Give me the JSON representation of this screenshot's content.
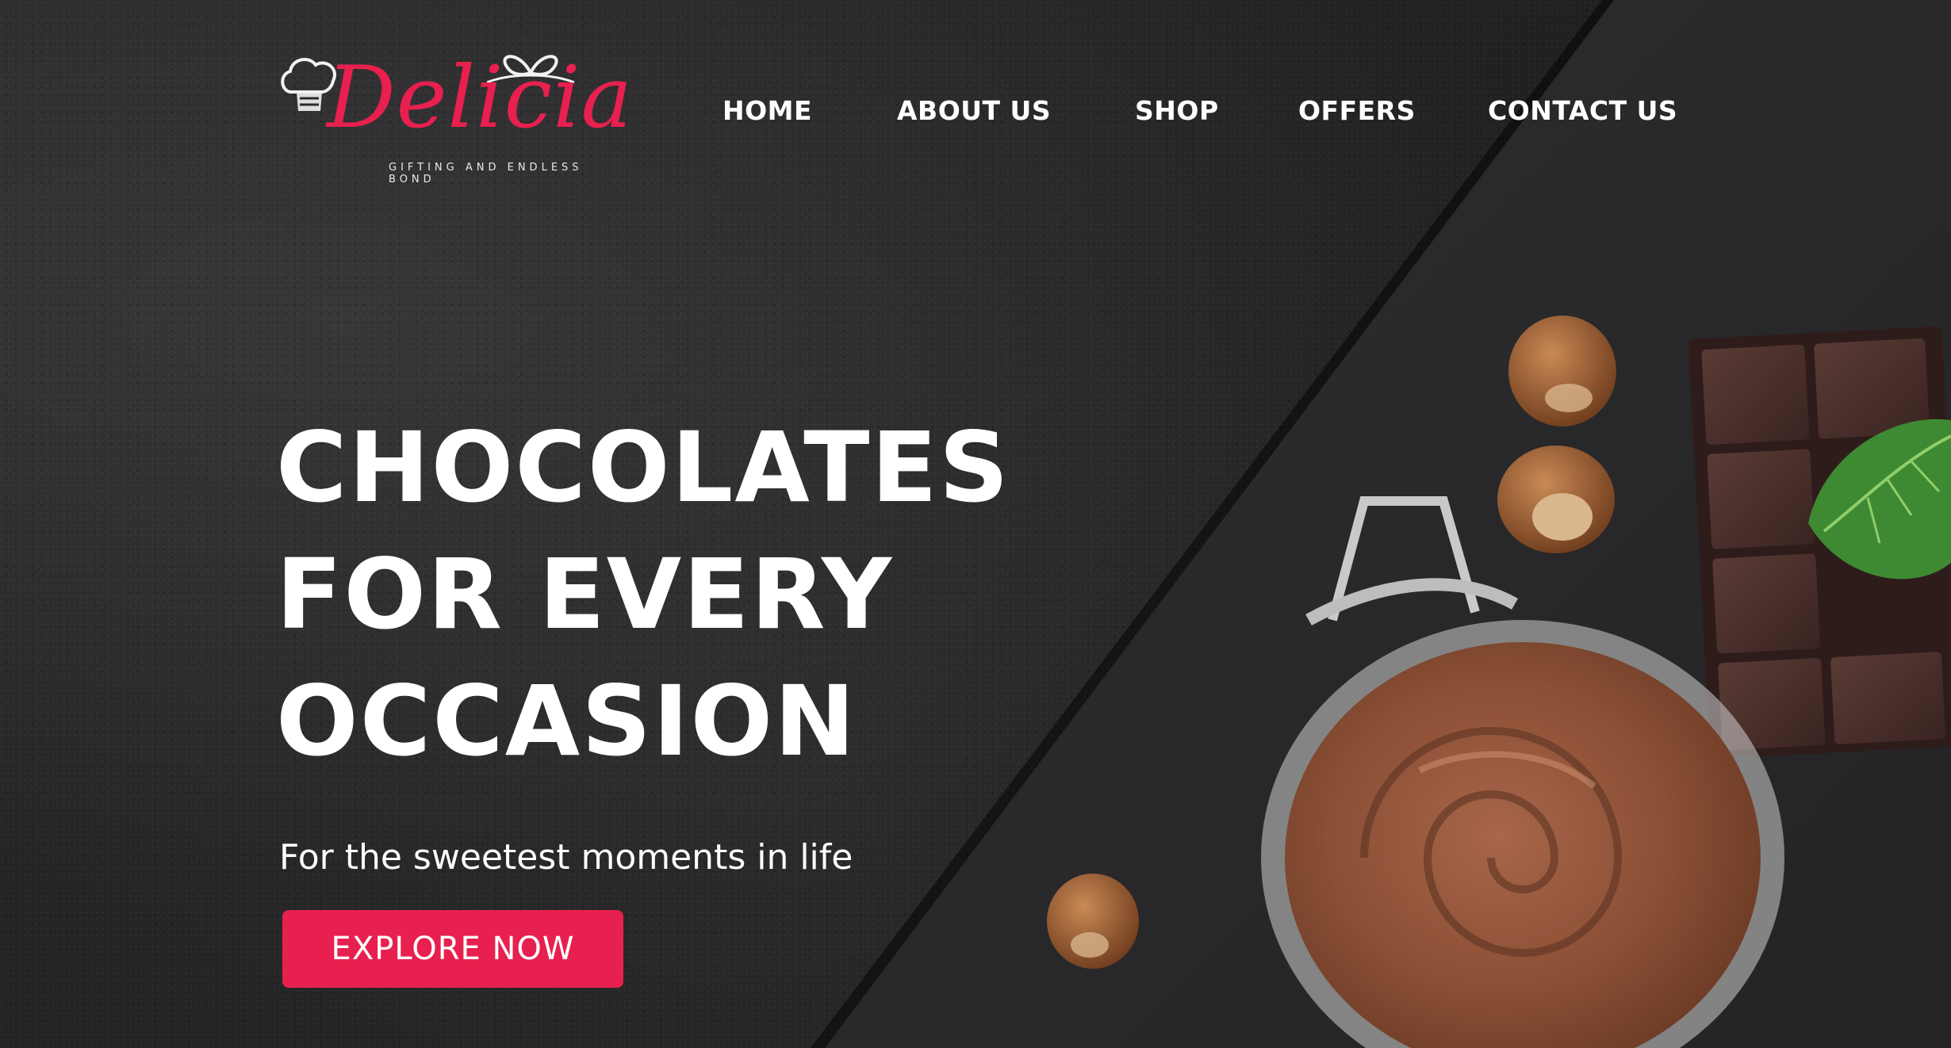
{
  "brand": {
    "name": "Delicia",
    "tagline": "GIFTING AND ENDLESS BOND",
    "primary_color": "#e8204f"
  },
  "nav": {
    "items": [
      {
        "label": "HOME"
      },
      {
        "label": "ABOUT US"
      },
      {
        "label": "SHOP"
      },
      {
        "label": "OFFERS"
      },
      {
        "label": "CONTACT US"
      }
    ]
  },
  "hero": {
    "headline": [
      "CHOCOLATES",
      "FOR EVERY",
      "OCCASION"
    ],
    "subtitle": "For the sweetest moments in life",
    "cta_label": "EXPLORE NOW"
  },
  "images": {
    "props": [
      "hazelnut",
      "hazelnut",
      "hazelnut",
      "chocolate-bar",
      "mint-leaf",
      "chocolate-spread-jar"
    ]
  }
}
